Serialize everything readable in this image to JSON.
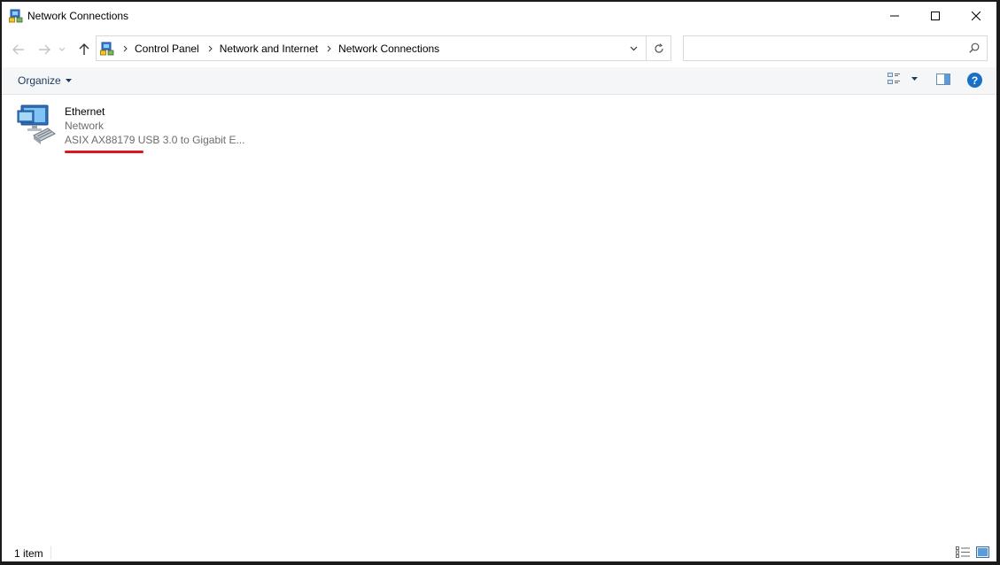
{
  "window": {
    "title": "Network Connections",
    "controls": {
      "minimize": "minimize-icon",
      "maximize": "maximize-icon",
      "close": "close-icon"
    }
  },
  "navigation": {
    "back": "back-arrow-icon",
    "forward": "forward-arrow-icon",
    "recent": "chevron-down-icon",
    "up": "up-arrow-icon"
  },
  "address": {
    "breadcrumbs": [
      "Control Panel",
      "Network and Internet",
      "Network Connections"
    ]
  },
  "search": {
    "placeholder": "",
    "value": ""
  },
  "command_bar": {
    "organize_label": "Organize"
  },
  "connections": [
    {
      "name": "Ethernet",
      "status": "Network",
      "device": "ASIX AX88179 USB 3.0 to Gigabit E..."
    }
  ],
  "status_bar": {
    "item_count": "1 item"
  },
  "colors": {
    "accent": "#1a6fc6",
    "highlight_mark": "#e0141e",
    "command_bar_bg": "#f5f6f7"
  }
}
